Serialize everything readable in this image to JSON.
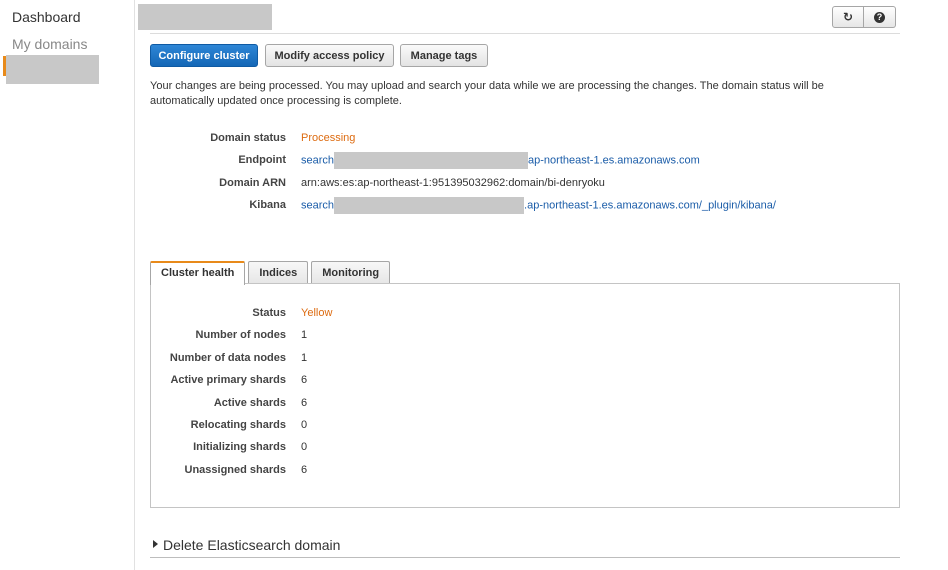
{
  "sidebar": {
    "items": [
      {
        "label": "Dashboard"
      },
      {
        "label": "My domains"
      }
    ]
  },
  "header": {
    "icons": [
      "refresh-icon",
      "help-icon"
    ]
  },
  "toolbar": {
    "configure_label": "Configure cluster",
    "access_label": "Modify access policy",
    "tags_label": "Manage tags"
  },
  "notice": "Your changes are being processed. You may upload and search your data while we are processing the changes. The domain status will be automatically updated once processing is complete.",
  "details": {
    "status_label": "Domain status",
    "status_value": "Processing",
    "endpoint_label": "Endpoint",
    "endpoint_prefix": "search",
    "endpoint_suffix": "ap-northeast-1.es.amazonaws.com",
    "arn_label": "Domain ARN",
    "arn_value": "arn:aws:es:ap-northeast-1:951395032962:domain/bi-denryoku",
    "kibana_label": "Kibana",
    "kibana_prefix": "search",
    "kibana_suffix": ".ap-northeast-1.es.amazonaws.com/_plugin/kibana/"
  },
  "tabs": [
    {
      "label": "Cluster health"
    },
    {
      "label": "Indices"
    },
    {
      "label": "Monitoring"
    }
  ],
  "health": [
    {
      "label": "Status",
      "value": "Yellow"
    },
    {
      "label": "Number of nodes",
      "value": "1"
    },
    {
      "label": "Number of data nodes",
      "value": "1"
    },
    {
      "label": "Active primary shards",
      "value": "6"
    },
    {
      "label": "Active shards",
      "value": "6"
    },
    {
      "label": "Relocating shards",
      "value": "0"
    },
    {
      "label": "Initializing shards",
      "value": "0"
    },
    {
      "label": "Unassigned shards",
      "value": "6"
    }
  ],
  "delete_label": "Delete Elasticsearch domain",
  "colors": {
    "accent": "#e88a1a",
    "primary": "#1a6fc4",
    "status_orange": "#dd6b10",
    "link": "#1a5ca8"
  }
}
